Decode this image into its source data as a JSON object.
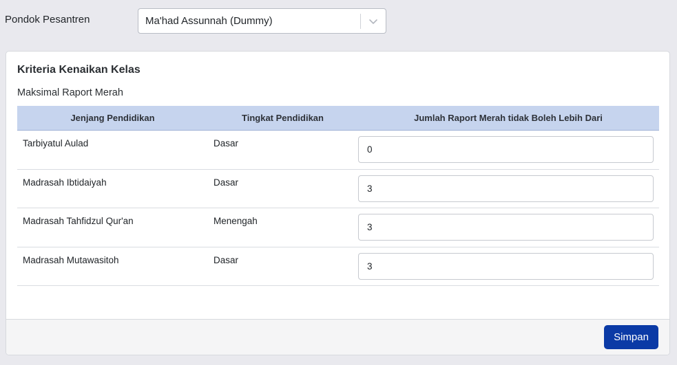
{
  "filter": {
    "label": "Pondok Pesantren",
    "selected": "Ma'had Assunnah (Dummy)"
  },
  "card": {
    "title": "Kriteria Kenaikan Kelas",
    "subtitle": "Maksimal Raport Merah",
    "columns": [
      "Jenjang Pendidikan",
      "Tingkat Pendidikan",
      "Jumlah Raport Merah tidak Boleh Lebih Dari"
    ],
    "rows": [
      {
        "jenjang": "Tarbiyatul Aulad",
        "tingkat": "Dasar",
        "max": "0"
      },
      {
        "jenjang": "Madrasah Ibtidaiyah",
        "tingkat": "Dasar",
        "max": "3"
      },
      {
        "jenjang": "Madrasah Tahfidzul Qur'an",
        "tingkat": "Menengah",
        "max": "3"
      },
      {
        "jenjang": "Madrasah Mutawasitoh",
        "tingkat": "Dasar",
        "max": "3"
      }
    ],
    "save_label": "Simpan"
  },
  "icons": {
    "select_chevron": "chevron-down-icon"
  },
  "colors": {
    "primary_button": "#0b3aa6",
    "table_header": "#c6d4ee",
    "page_background": "#e9e9ee"
  }
}
